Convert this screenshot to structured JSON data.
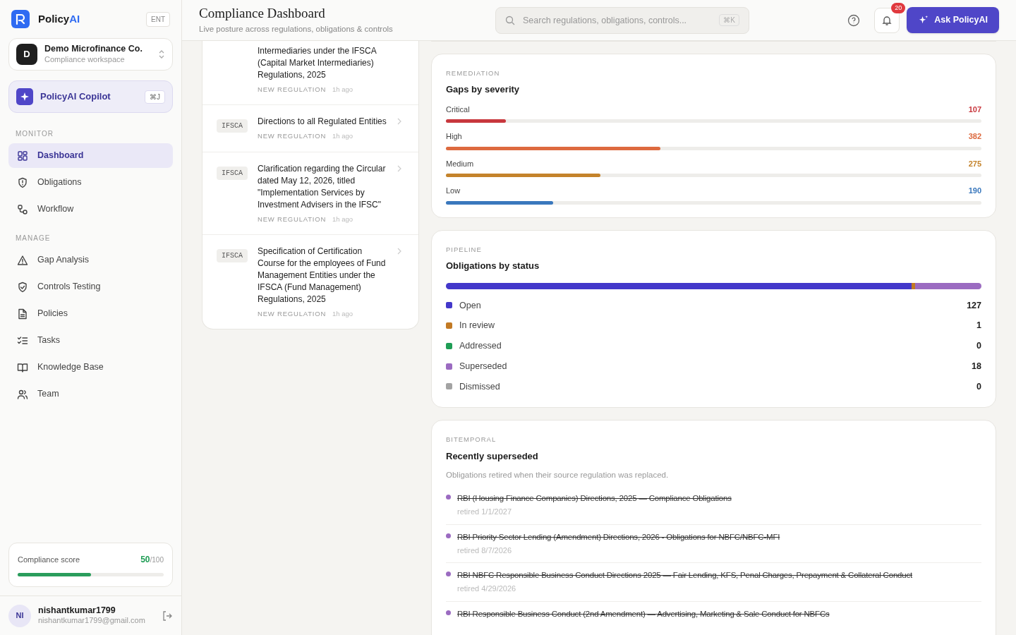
{
  "brand": {
    "name": "Policy",
    "name_accent": "AI",
    "badge": "ENT"
  },
  "workspace": {
    "initial": "D",
    "name": "Demo Microfinance Co.",
    "subtitle": "Compliance workspace"
  },
  "copilot": {
    "label": "PolicyAI Copilot",
    "shortcut": "⌘J"
  },
  "nav_sections": [
    {
      "heading": "MONITOR",
      "items": [
        {
          "label": "Dashboard",
          "selected": true
        },
        {
          "label": "Obligations",
          "selected": false
        },
        {
          "label": "Workflow",
          "selected": false
        }
      ]
    },
    {
      "heading": "MANAGE",
      "items": [
        {
          "label": "Gap Analysis",
          "selected": false
        },
        {
          "label": "Controls Testing",
          "selected": false
        },
        {
          "label": "Policies",
          "selected": false
        },
        {
          "label": "Tasks",
          "selected": false
        },
        {
          "label": "Knowledge Base",
          "selected": false
        },
        {
          "label": "Team",
          "selected": false
        }
      ]
    }
  ],
  "score": {
    "label": "Compliance score",
    "value": "50",
    "max": "/100",
    "level": 0.5
  },
  "user": {
    "initials": "NI",
    "name": "nishantkumar1799",
    "email": "nishantkumar1799@gmail.com"
  },
  "header": {
    "title": "Compliance Dashboard",
    "subtitle": "Live posture across regulations, obligations & controls",
    "search_placeholder": "Search regulations, obligations, controls...",
    "search_shortcut": "⌘K",
    "notifications": "20",
    "ask_button": "Ask PolicyAI"
  },
  "feed": [
    {
      "title": "Intermediaries under the IFSCA (Capital Market Intermediaries) Regulations, 2025",
      "type": "NEW REGULATION",
      "time": "1h ago"
    },
    {
      "tag": "IFSCA",
      "title": "Directions to all Regulated Entities",
      "type": "NEW REGULATION",
      "time": "1h ago"
    },
    {
      "tag": "IFSCA",
      "title": "Clarification regarding the Circular dated May 12, 2026, titled \"Implementation Services by Investment Advisers in the IFSC\"",
      "type": "NEW REGULATION",
      "time": "1h ago"
    },
    {
      "tag": "IFSCA",
      "title": "Specification of Certification Course for the employees of Fund Management Entities under the IFSCA (Fund Management) Regulations, 2025",
      "type": "NEW REGULATION",
      "time": "1h ago"
    }
  ],
  "severity": {
    "eyebrow": "REMEDIATION",
    "title": "Gaps by severity",
    "rows": [
      {
        "label": "Critical",
        "count": "107",
        "color": "#c8373d",
        "level": 0.112
      },
      {
        "label": "High",
        "count": "382",
        "color": "#dd6a3f",
        "level": 0.4
      },
      {
        "label": "Medium",
        "count": "275",
        "color": "#c4832b",
        "level": 0.288
      },
      {
        "label": "Low",
        "count": "190",
        "color": "#3a78bd",
        "level": 0.2
      }
    ]
  },
  "pipeline": {
    "eyebrow": "PIPELINE",
    "title": "Obligations by status",
    "statuses": [
      {
        "label": "Open",
        "count": "127",
        "color": "#4338ca"
      },
      {
        "label": "In review",
        "count": "1",
        "color": "#c27a24"
      },
      {
        "label": "Addressed",
        "count": "0",
        "color": "#1f9d55"
      },
      {
        "label": "Superseded",
        "count": "18",
        "color": "#9b6bc1"
      },
      {
        "label": "Dismissed",
        "count": "0",
        "color": "#a3a3a3"
      }
    ]
  },
  "superseded": {
    "eyebrow": "BITEMPORAL",
    "title": "Recently superseded",
    "description": "Obligations retired when their source regulation was replaced.",
    "items": [
      {
        "title": "RBI (Housing Finance Companies) Directions, 2025 — Compliance Obligations",
        "retired": "retired 1/1/2027"
      },
      {
        "title": "RBI Priority Sector Lending (Amendment) Directions, 2026 - Obligations for NBFC/NBFC-MFI",
        "retired": "retired 8/7/2026"
      },
      {
        "title": "RBI NBFC Responsible Business Conduct Directions 2025 — Fair Lending, KFS, Penal Charges, Prepayment & Collateral Conduct",
        "retired": "retired 4/29/2026"
      },
      {
        "title": "RBI Responsible Business Conduct (2nd Amendment) — Advertising, Marketing & Sale Conduct for NBFCs"
      }
    ]
  }
}
